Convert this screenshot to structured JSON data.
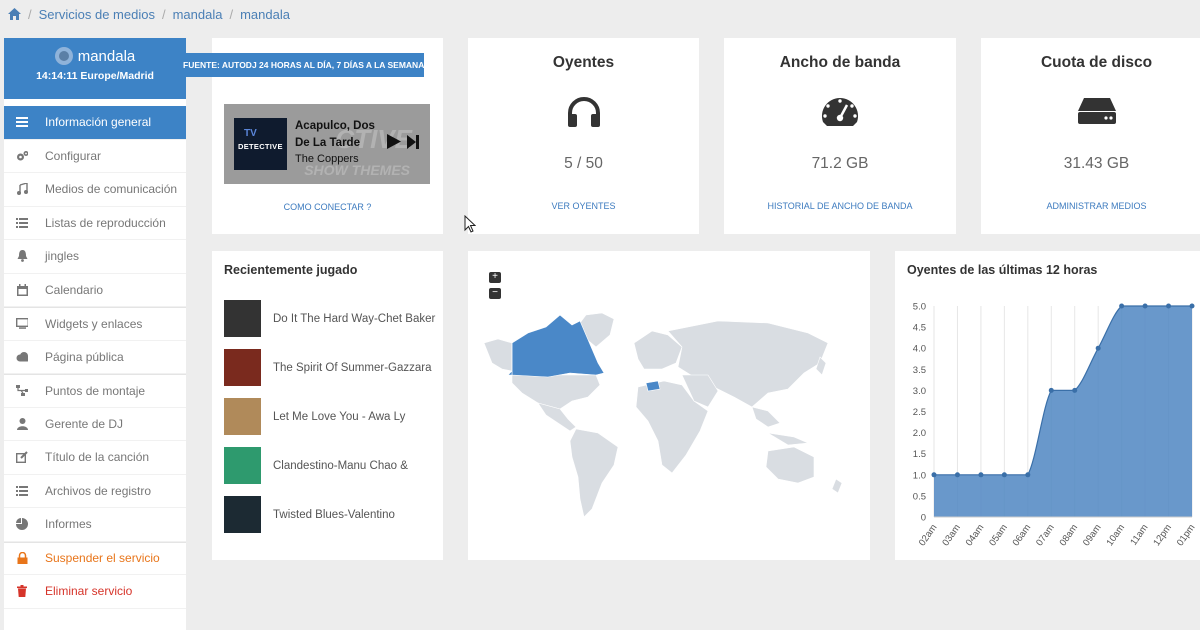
{
  "breadcrumb": {
    "items": [
      "Servicios de medios",
      "mandala",
      "mandala"
    ]
  },
  "sidebar": {
    "title": "mandala",
    "time": "14:14:11 Europe/Madrid",
    "items": [
      {
        "label": "Información general",
        "icon": "bars-icon"
      },
      {
        "label": "Configurar",
        "icon": "gears-icon"
      },
      {
        "label": "Medios de comunicación",
        "icon": "music-icon"
      },
      {
        "label": "Listas de reproducción",
        "icon": "list-icon"
      },
      {
        "label": "jingles",
        "icon": "bell-icon"
      },
      {
        "label": "Calendario",
        "icon": "calendar-icon"
      },
      {
        "label": "Widgets y enlaces",
        "icon": "monitor-icon"
      },
      {
        "label": "Página pública",
        "icon": "cloud-icon"
      },
      {
        "label": "Puntos de montaje",
        "icon": "sitemap-icon"
      },
      {
        "label": "Gerente de DJ",
        "icon": "user-icon"
      },
      {
        "label": "Título de la canción",
        "icon": "edit-icon"
      },
      {
        "label": "Archivos de registro",
        "icon": "list-icon"
      },
      {
        "label": "Informes",
        "icon": "pie-icon"
      },
      {
        "label": "Suspender el servicio",
        "icon": "lock-icon"
      },
      {
        "label": "Eliminar servicio",
        "icon": "trash-icon"
      }
    ]
  },
  "source_badge": "FUENTE: AUTODJ 24 HORAS AL DÍA, 7 DÍAS A LA SEMANA",
  "player": {
    "bg_text_1": "CTIVE",
    "bg_text_2": "SHOW THEMES",
    "album_text_1": "TV",
    "album_text_2": "DETECTIVE",
    "title": "Acapulco, Dos De La Tarde",
    "artist": "The Coppers",
    "connect_link": "COMO CONECTAR ?"
  },
  "stats": [
    {
      "title": "Oyentes",
      "value": "5 / 50",
      "link": "VER OYENTES",
      "icon": "headphones-icon"
    },
    {
      "title": "Ancho de banda",
      "value": "71.2 GB",
      "link": "HISTORIAL DE ANCHO DE BANDA",
      "icon": "gauge-icon"
    },
    {
      "title": "Cuota de disco",
      "value": "31.43 GB",
      "link": "ADMINISTRAR MEDIOS",
      "icon": "hdd-icon"
    }
  ],
  "recent": {
    "title": "Recientemente jugado",
    "items": [
      {
        "text": "Do It The Hard Way-Chet Baker",
        "thumb_color": "#333333"
      },
      {
        "text": "The Spirit Of Summer-Gazzara",
        "thumb_color": "#7a2a1e"
      },
      {
        "text": "Let Me Love You - Awa Ly",
        "thumb_color": "#b08a5a"
      },
      {
        "text": "Clandestino-Manu Chao &",
        "thumb_color": "#2e9a6e"
      },
      {
        "text": "Twisted Blues-Valentino",
        "thumb_color": "#1c2a33"
      }
    ]
  },
  "map": {
    "zoom_in": "+",
    "zoom_out": "−",
    "highlight_color": "#4a88c8",
    "land_color": "#d9dde2"
  },
  "chart_data": {
    "type": "area",
    "title": "Oyentes de las últimas 12 horas",
    "categories": [
      "02am",
      "03am",
      "04am",
      "05am",
      "06am",
      "07am",
      "08am",
      "09am",
      "10am",
      "11am",
      "12pm",
      "01pm"
    ],
    "values": [
      1,
      1,
      1,
      1,
      1,
      3,
      3,
      4,
      5,
      5,
      5,
      5
    ],
    "y_ticks": [
      "0",
      "0.5",
      "1.0",
      "1.5",
      "2.0",
      "2.5",
      "3.0",
      "3.5",
      "4.0",
      "4.5",
      "5.0"
    ],
    "ylim": [
      0,
      5
    ],
    "color": "#4f86c2"
  }
}
